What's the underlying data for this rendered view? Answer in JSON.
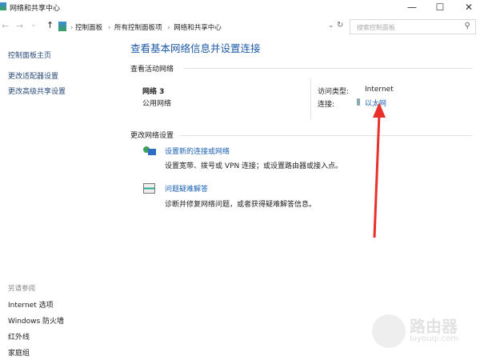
{
  "window": {
    "title": "网络和共享中心",
    "minimize": "—",
    "maximize": "☐",
    "close": "✕"
  },
  "address": {
    "breadcrumb": [
      "控制面板",
      "所有控制面板项",
      "网络和共享中心"
    ],
    "separator": "›",
    "dropdown": "⌄",
    "refresh": "↻",
    "search_placeholder": "搜索控制面板",
    "search_icon": "⚲",
    "back": "←",
    "forward": "→",
    "recent": "⌄",
    "up": "↑"
  },
  "sidebar": {
    "items": [
      "控制面板主页",
      "更改适配器设置",
      "更改高级共享设置"
    ],
    "see_also_title": "另请参阅",
    "see_also": [
      "Internet 选项",
      "Windows 防火墙",
      "红外线",
      "家庭组"
    ]
  },
  "main": {
    "title": "查看基本网络信息并设置连接",
    "active_section": "查看活动网络",
    "network_name": "网络 3",
    "network_type": "公用网络",
    "access_label": "访问类型:",
    "access_value": "Internet",
    "conn_label": "连接:",
    "conn_value": "以太网",
    "change_section": "更改网络设置",
    "tasks": [
      {
        "title": "设置新的连接或网络",
        "desc": "设置宽带、拨号或 VPN 连接；或设置路由器或接入点。"
      },
      {
        "title": "问题疑难解答",
        "desc": "诊断并修复网络问题，或者获得疑难解答信息。"
      }
    ]
  },
  "watermark": {
    "brand": "路由器",
    "url": "luyouqi.com"
  },
  "colors": {
    "link": "#1a5fb4",
    "arrow": "#e8302a"
  }
}
